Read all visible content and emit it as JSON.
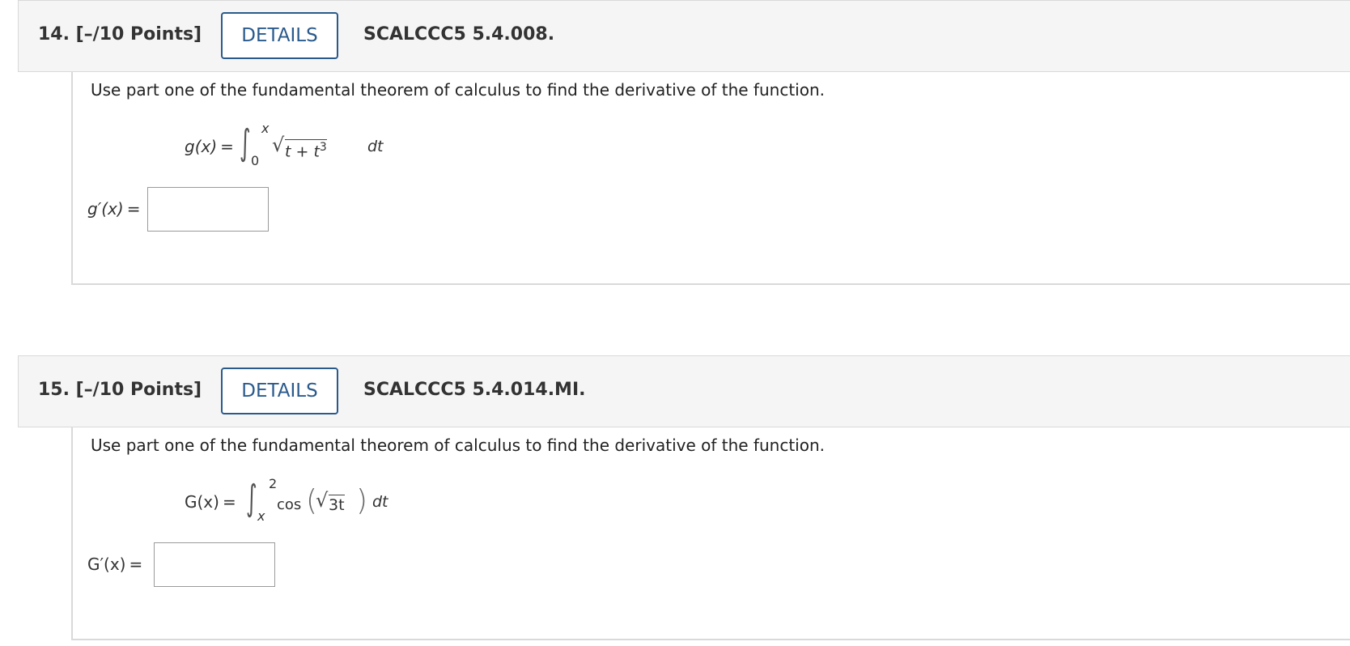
{
  "problems": [
    {
      "number_points": "14. [–/10 Points]",
      "details_label": "DETAILS",
      "code": "SCALCCC5 5.4.008.",
      "question": "Use part one of the fundamental theorem of calculus to find the derivative of the function.",
      "fn_name": "g(x)",
      "equals": "=",
      "upper_limit": "x",
      "lower_limit": "0",
      "integrand": "t + t",
      "integrand_exp": "3",
      "differential": "dt",
      "answer_label": "g′(x)",
      "answer_value": ""
    },
    {
      "number_points": "15. [–/10 Points]",
      "details_label": "DETAILS",
      "code": "SCALCCC5 5.4.014.MI.",
      "question": "Use part one of the fundamental theorem of calculus to find the derivative of the function.",
      "fn_name": "G(x)",
      "equals": "=",
      "upper_limit": "2",
      "lower_limit": "x",
      "cos_label": "cos",
      "integrand": "3t",
      "differential": "dt",
      "answer_label": "G′(x)",
      "answer_value": ""
    }
  ]
}
